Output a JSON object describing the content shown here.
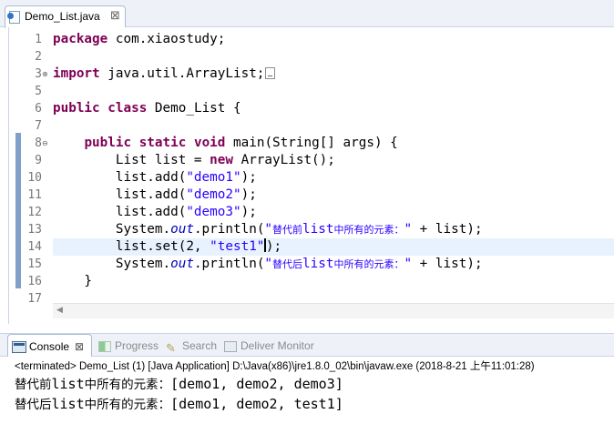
{
  "editor": {
    "tab_label": "Demo_List.java",
    "tab_close": "⊠",
    "lines": [
      {
        "num": "1",
        "code": "package com.xiaostudy;"
      },
      {
        "num": "2",
        "code": ""
      },
      {
        "num": "3",
        "code": "import java.util.ArrayList;"
      },
      {
        "num": "5",
        "code": ""
      },
      {
        "num": "6",
        "code": "public class Demo_List {"
      },
      {
        "num": "7",
        "code": ""
      },
      {
        "num": "8",
        "code": "    public static void main(String[] args) {"
      },
      {
        "num": "9",
        "code": "        List list = new ArrayList();"
      },
      {
        "num": "10",
        "code": "        list.add(\"demo1\");"
      },
      {
        "num": "11",
        "code": "        list.add(\"demo2\");"
      },
      {
        "num": "12",
        "code": "        list.add(\"demo3\");"
      },
      {
        "num": "13",
        "code": "        System.out.println(\"替代前list中所有的元素：\" + list);"
      },
      {
        "num": "14",
        "code": "        list.set(2, \"test1\");"
      },
      {
        "num": "15",
        "code": "        System.out.println(\"替代后list中所有的元素：\" + list);"
      },
      {
        "num": "16",
        "code": "    }"
      },
      {
        "num": "17",
        "code": ""
      }
    ],
    "current_line": "14"
  },
  "views": {
    "console_label": "Console",
    "console_close": "⊠",
    "progress_label": "Progress",
    "search_label": "Search",
    "deliver_label": "Deliver Monitor"
  },
  "console": {
    "status": "<terminated> Demo_List (1) [Java Application] D:\\Java(x86)\\jre1.8.0_02\\bin\\javaw.exe (2018-8-21 上午11:01:28)",
    "output_line1": "替代前list中所有的元素：[demo1, demo2, demo3]",
    "output_line2": "替代后list中所有的元素：[demo1, demo2, test1]"
  },
  "colors": {
    "keyword": "#7f0055",
    "string": "#2a00ff",
    "static_field": "#0000c0",
    "line_number": "#787878",
    "current_line_bg": "#e8f2fe"
  }
}
